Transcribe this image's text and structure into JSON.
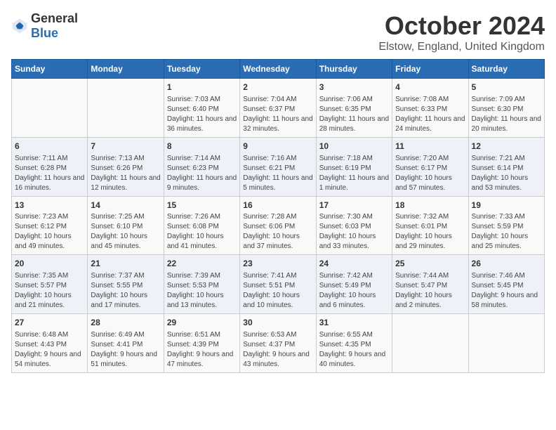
{
  "header": {
    "logo_general": "General",
    "logo_blue": "Blue",
    "month_title": "October 2024",
    "location": "Elstow, England, United Kingdom"
  },
  "days_of_week": [
    "Sunday",
    "Monday",
    "Tuesday",
    "Wednesday",
    "Thursday",
    "Friday",
    "Saturday"
  ],
  "weeks": [
    [
      {
        "day": "",
        "info": ""
      },
      {
        "day": "",
        "info": ""
      },
      {
        "day": "1",
        "info": "Sunrise: 7:03 AM\nSunset: 6:40 PM\nDaylight: 11 hours and 36 minutes."
      },
      {
        "day": "2",
        "info": "Sunrise: 7:04 AM\nSunset: 6:37 PM\nDaylight: 11 hours and 32 minutes."
      },
      {
        "day": "3",
        "info": "Sunrise: 7:06 AM\nSunset: 6:35 PM\nDaylight: 11 hours and 28 minutes."
      },
      {
        "day": "4",
        "info": "Sunrise: 7:08 AM\nSunset: 6:33 PM\nDaylight: 11 hours and 24 minutes."
      },
      {
        "day": "5",
        "info": "Sunrise: 7:09 AM\nSunset: 6:30 PM\nDaylight: 11 hours and 20 minutes."
      }
    ],
    [
      {
        "day": "6",
        "info": "Sunrise: 7:11 AM\nSunset: 6:28 PM\nDaylight: 11 hours and 16 minutes."
      },
      {
        "day": "7",
        "info": "Sunrise: 7:13 AM\nSunset: 6:26 PM\nDaylight: 11 hours and 12 minutes."
      },
      {
        "day": "8",
        "info": "Sunrise: 7:14 AM\nSunset: 6:23 PM\nDaylight: 11 hours and 9 minutes."
      },
      {
        "day": "9",
        "info": "Sunrise: 7:16 AM\nSunset: 6:21 PM\nDaylight: 11 hours and 5 minutes."
      },
      {
        "day": "10",
        "info": "Sunrise: 7:18 AM\nSunset: 6:19 PM\nDaylight: 11 hours and 1 minute."
      },
      {
        "day": "11",
        "info": "Sunrise: 7:20 AM\nSunset: 6:17 PM\nDaylight: 10 hours and 57 minutes."
      },
      {
        "day": "12",
        "info": "Sunrise: 7:21 AM\nSunset: 6:14 PM\nDaylight: 10 hours and 53 minutes."
      }
    ],
    [
      {
        "day": "13",
        "info": "Sunrise: 7:23 AM\nSunset: 6:12 PM\nDaylight: 10 hours and 49 minutes."
      },
      {
        "day": "14",
        "info": "Sunrise: 7:25 AM\nSunset: 6:10 PM\nDaylight: 10 hours and 45 minutes."
      },
      {
        "day": "15",
        "info": "Sunrise: 7:26 AM\nSunset: 6:08 PM\nDaylight: 10 hours and 41 minutes."
      },
      {
        "day": "16",
        "info": "Sunrise: 7:28 AM\nSunset: 6:06 PM\nDaylight: 10 hours and 37 minutes."
      },
      {
        "day": "17",
        "info": "Sunrise: 7:30 AM\nSunset: 6:03 PM\nDaylight: 10 hours and 33 minutes."
      },
      {
        "day": "18",
        "info": "Sunrise: 7:32 AM\nSunset: 6:01 PM\nDaylight: 10 hours and 29 minutes."
      },
      {
        "day": "19",
        "info": "Sunrise: 7:33 AM\nSunset: 5:59 PM\nDaylight: 10 hours and 25 minutes."
      }
    ],
    [
      {
        "day": "20",
        "info": "Sunrise: 7:35 AM\nSunset: 5:57 PM\nDaylight: 10 hours and 21 minutes."
      },
      {
        "day": "21",
        "info": "Sunrise: 7:37 AM\nSunset: 5:55 PM\nDaylight: 10 hours and 17 minutes."
      },
      {
        "day": "22",
        "info": "Sunrise: 7:39 AM\nSunset: 5:53 PM\nDaylight: 10 hours and 13 minutes."
      },
      {
        "day": "23",
        "info": "Sunrise: 7:41 AM\nSunset: 5:51 PM\nDaylight: 10 hours and 10 minutes."
      },
      {
        "day": "24",
        "info": "Sunrise: 7:42 AM\nSunset: 5:49 PM\nDaylight: 10 hours and 6 minutes."
      },
      {
        "day": "25",
        "info": "Sunrise: 7:44 AM\nSunset: 5:47 PM\nDaylight: 10 hours and 2 minutes."
      },
      {
        "day": "26",
        "info": "Sunrise: 7:46 AM\nSunset: 5:45 PM\nDaylight: 9 hours and 58 minutes."
      }
    ],
    [
      {
        "day": "27",
        "info": "Sunrise: 6:48 AM\nSunset: 4:43 PM\nDaylight: 9 hours and 54 minutes."
      },
      {
        "day": "28",
        "info": "Sunrise: 6:49 AM\nSunset: 4:41 PM\nDaylight: 9 hours and 51 minutes."
      },
      {
        "day": "29",
        "info": "Sunrise: 6:51 AM\nSunset: 4:39 PM\nDaylight: 9 hours and 47 minutes."
      },
      {
        "day": "30",
        "info": "Sunrise: 6:53 AM\nSunset: 4:37 PM\nDaylight: 9 hours and 43 minutes."
      },
      {
        "day": "31",
        "info": "Sunrise: 6:55 AM\nSunset: 4:35 PM\nDaylight: 9 hours and 40 minutes."
      },
      {
        "day": "",
        "info": ""
      },
      {
        "day": "",
        "info": ""
      }
    ]
  ]
}
